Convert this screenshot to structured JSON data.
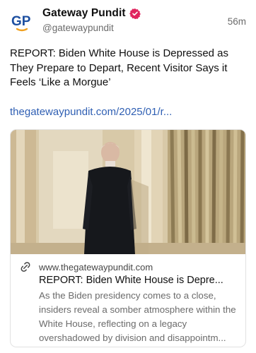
{
  "post": {
    "author": {
      "name": "Gateway Pundit",
      "handle": "@gatewaypundit",
      "avatar_text": "GP",
      "verified": true
    },
    "timestamp": "56m",
    "text": "REPORT: Biden White House is Depressed as They Prepare to Depart, Recent Visitor Says it Feels ‘Like a Morgue’",
    "link_text": "thegatewaypundit.com/2025/01/r..."
  },
  "link_card": {
    "domain": "www.thegatewaypundit.com",
    "title": "REPORT: Biden White House is Depre...",
    "description": "As the Biden presidency comes to a close, insiders reveal a somber atmosphere within the White House, reflecting on a legacy overshadowed by division and disappointm...",
    "icons": {
      "link": "link-icon"
    }
  },
  "colors": {
    "brand_blue": "#1d4fa0",
    "brand_orange": "#f0a020",
    "link": "#2f5fb3",
    "verified": "#e0245e",
    "muted": "#6b6b6b"
  }
}
